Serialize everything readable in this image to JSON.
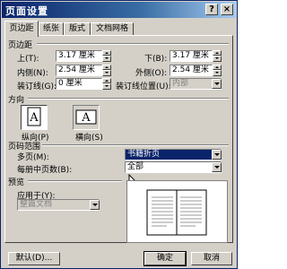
{
  "window": {
    "title": "页面设置"
  },
  "titlebar": {
    "help_label": "?",
    "close_label": "×"
  },
  "tabs": [
    {
      "label": "页边距"
    },
    {
      "label": "纸张"
    },
    {
      "label": "版式"
    },
    {
      "label": "文档网格"
    }
  ],
  "margins": {
    "group_title": "页边距",
    "top_label": "上(T):",
    "top_value": "3.17 厘米",
    "bottom_label": "下(B):",
    "bottom_value": "3.17 厘米",
    "inside_label": "内侧(N):",
    "inside_value": "2.54 厘米",
    "outside_label": "外侧(O):",
    "outside_value": "2.54 厘米",
    "gutter_label": "装订线(G):",
    "gutter_value": "0 厘米",
    "gutter_pos_label": "装订线位置(U):",
    "gutter_pos_value": "内部"
  },
  "orientation": {
    "group_title": "方向",
    "portrait_label": "纵向(P)",
    "landscape_label": "横向(S)",
    "glyph": "A"
  },
  "pages": {
    "group_title": "页码范围",
    "multiple_label": "多页(M):",
    "multiple_value": "书籍折页",
    "sheets_label": "每册中页数(B):",
    "sheets_value": "全部"
  },
  "preview": {
    "group_title": "预览",
    "apply_label": "应用于(Y):",
    "apply_value": "整篇文档"
  },
  "buttons": {
    "default_label": "默认(D)...",
    "ok_label": "确定",
    "cancel_label": "取消"
  }
}
